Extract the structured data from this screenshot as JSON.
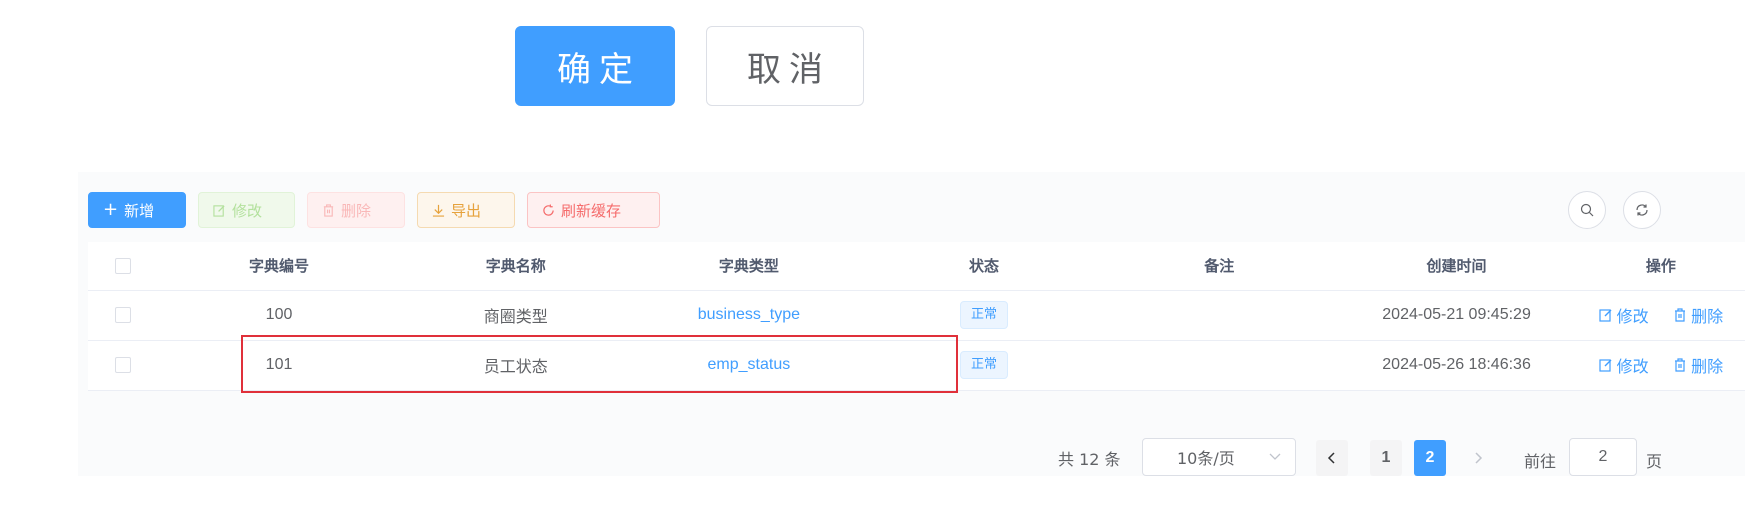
{
  "dialog": {
    "confirm_label": "确定",
    "cancel_label": "取消"
  },
  "toolbar": {
    "add_label": "新增",
    "edit_label": "修改",
    "delete_label": "删除",
    "export_label": "导出",
    "refresh_cache_label": "刷新缓存",
    "icons": [
      "search-icon",
      "refresh-icon"
    ]
  },
  "table": {
    "headers": [
      "字典编号",
      "字典名称",
      "字典类型",
      "状态",
      "备注",
      "创建时间",
      "操作"
    ],
    "rows": [
      {
        "code": "100",
        "name": "商圈类型",
        "type": "business_type",
        "status": "正常",
        "remark": "",
        "created": "2024-05-21 09:45:29",
        "edit": "修改",
        "delete": "删除"
      },
      {
        "code": "101",
        "name": "员工状态",
        "type": "emp_status",
        "status": "正常",
        "remark": "",
        "created": "2024-05-26 18:46:36",
        "edit": "修改",
        "delete": "删除"
      }
    ]
  },
  "pagination": {
    "total_text": "共 12 条",
    "page_size": "10条/页",
    "pages": [
      "1",
      "2"
    ],
    "current_page": "2",
    "goto_label": "前往",
    "goto_value": "2",
    "goto_suffix": "页"
  },
  "colors": {
    "primary": "#409eff",
    "highlight_border": "#e0303a"
  }
}
